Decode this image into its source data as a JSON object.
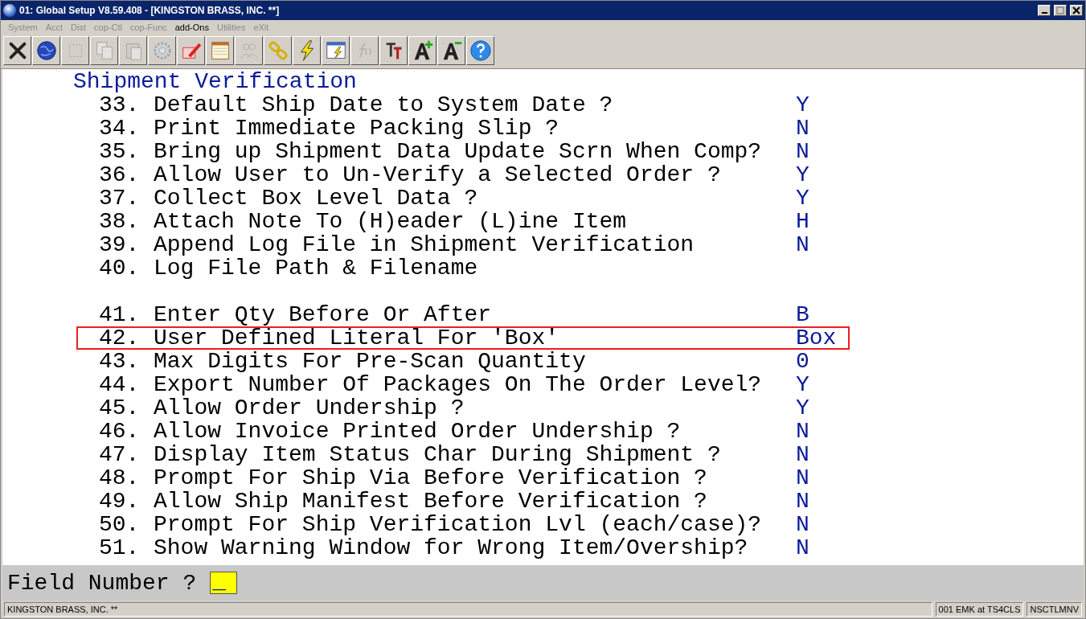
{
  "window": {
    "title": "01: Global Setup V8.59.408 - [KINGSTON BRASS, INC. **]"
  },
  "menu": [
    {
      "label": "System",
      "disabled": true
    },
    {
      "label": "Acct",
      "disabled": true
    },
    {
      "label": "Dist",
      "disabled": true
    },
    {
      "label": "cop-Ctl",
      "disabled": true
    },
    {
      "label": "cop-Func",
      "disabled": true
    },
    {
      "label": "add-Ons",
      "disabled": false
    },
    {
      "label": "Utilities",
      "disabled": true
    },
    {
      "label": "eXit",
      "disabled": true
    }
  ],
  "toolbar": [
    {
      "kind": "close",
      "disabled": false
    },
    {
      "kind": "globe",
      "disabled": false
    },
    {
      "kind": "select",
      "disabled": true
    },
    {
      "kind": "copy",
      "disabled": true
    },
    {
      "kind": "paste",
      "disabled": true
    },
    {
      "kind": "gear",
      "disabled": true
    },
    {
      "kind": "pencil",
      "disabled": false
    },
    {
      "kind": "table",
      "disabled": false
    },
    {
      "kind": "people",
      "disabled": true
    },
    {
      "kind": "chain",
      "disabled": false
    },
    {
      "kind": "bolt",
      "disabled": false
    },
    {
      "kind": "window-bolt",
      "disabled": false
    },
    {
      "kind": "fx",
      "disabled": true
    },
    {
      "kind": "tt",
      "disabled": false
    },
    {
      "kind": "font-plus",
      "disabled": false
    },
    {
      "kind": "font-minus",
      "disabled": false
    },
    {
      "kind": "help",
      "disabled": false
    }
  ],
  "section_title": "Shipment Verification",
  "rows": [
    {
      "kind": "field",
      "number": "33.",
      "label": "Default Ship Date to System Date ?",
      "value": "Y",
      "highlighted": false
    },
    {
      "kind": "field",
      "number": "34.",
      "label": "Print Immediate Packing Slip ?",
      "value": "N",
      "highlighted": false
    },
    {
      "kind": "field",
      "number": "35.",
      "label": "Bring up Shipment Data Update Scrn When Comp?",
      "value": "N",
      "highlighted": false
    },
    {
      "kind": "field",
      "number": "36.",
      "label": "Allow User to Un-Verify a Selected Order ?",
      "value": "Y",
      "highlighted": false
    },
    {
      "kind": "field",
      "number": "37.",
      "label": "Collect Box Level Data ?",
      "value": "Y",
      "highlighted": false
    },
    {
      "kind": "field",
      "number": "38.",
      "label": "Attach Note To (H)eader (L)ine Item",
      "value": "H",
      "highlighted": false
    },
    {
      "kind": "field",
      "number": "39.",
      "label": "Append Log File in Shipment Verification",
      "value": "N",
      "highlighted": false
    },
    {
      "kind": "field",
      "number": "40.",
      "label": "Log File Path & Filename",
      "highlighted": false
    },
    {
      "kind": "blank"
    },
    {
      "kind": "field",
      "number": "41.",
      "label": "Enter Qty Before Or After",
      "value": "B",
      "highlighted": false
    },
    {
      "kind": "field",
      "number": "42.",
      "label": "User Defined Literal For 'Box'",
      "value": "Box",
      "highlighted": true
    },
    {
      "kind": "field",
      "number": "43.",
      "label": "Max Digits For Pre-Scan Quantity",
      "value": "0",
      "highlighted": false
    },
    {
      "kind": "field",
      "number": "44.",
      "label": "Export Number Of Packages On The Order Level?",
      "value": "Y",
      "highlighted": false
    },
    {
      "kind": "field",
      "number": "45.",
      "label": "Allow Order Undership ?",
      "value": "Y",
      "highlighted": false
    },
    {
      "kind": "field",
      "number": "46.",
      "label": "Allow Invoice Printed Order Undership ?",
      "value": "N",
      "highlighted": false
    },
    {
      "kind": "field",
      "number": "47.",
      "label": "Display Item Status Char During Shipment ?",
      "value": "N",
      "highlighted": false
    },
    {
      "kind": "field",
      "number": "48.",
      "label": "Prompt For Ship Via Before Verification ?",
      "value": "N",
      "highlighted": false
    },
    {
      "kind": "field",
      "number": "49.",
      "label": "Allow Ship Manifest Before Verification ?",
      "value": "N",
      "highlighted": false
    },
    {
      "kind": "field",
      "number": "50.",
      "label": "Prompt For Ship Verification Lvl (each/case)?",
      "value": "N",
      "highlighted": false
    },
    {
      "kind": "field",
      "number": "51.",
      "label": "Show Warning Window for Wrong Item/Overship?",
      "value": "N",
      "highlighted": false
    }
  ],
  "prompt": {
    "label": "Field Number ?",
    "value": "_"
  },
  "status_bar": [
    "KINGSTON BRASS, INC. **",
    "001 EMK at TS4CLS",
    "NSCTLMNV"
  ]
}
